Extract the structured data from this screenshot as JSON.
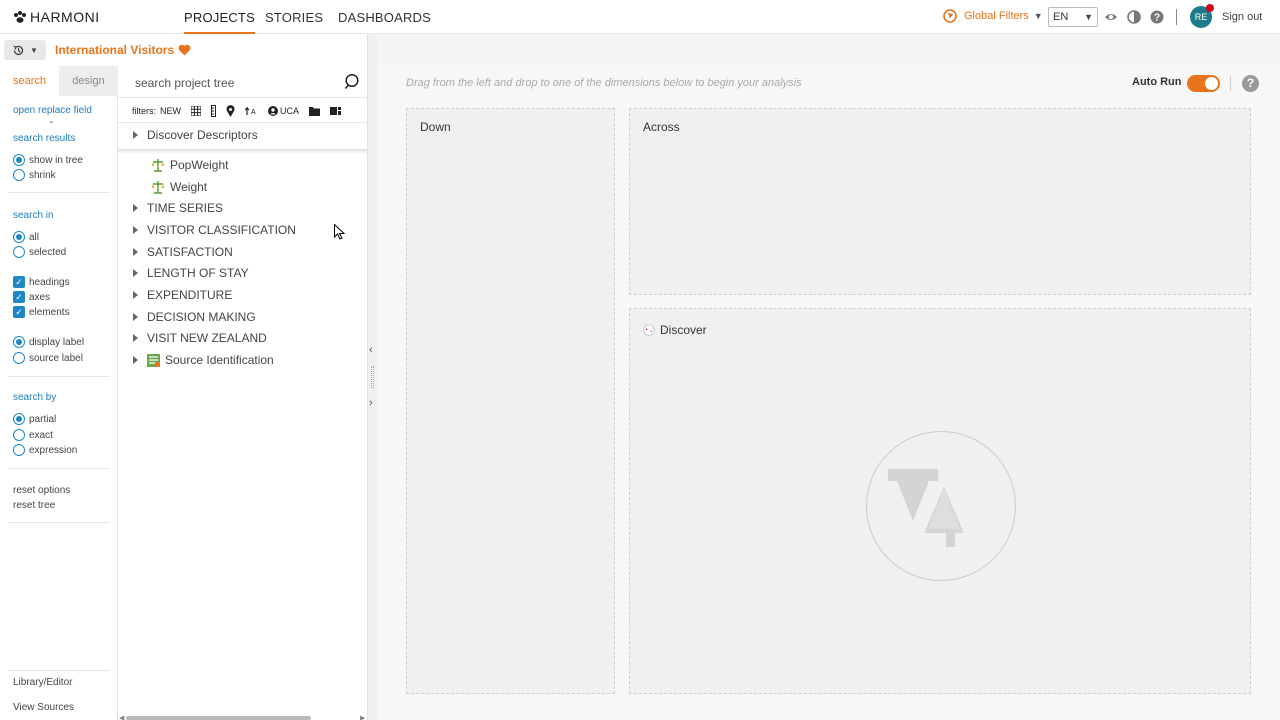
{
  "app": {
    "brand": "HARMONI",
    "nav": [
      {
        "label": "PROJECTS",
        "active": true
      },
      {
        "label": "STORIES",
        "active": false
      },
      {
        "label": "DASHBOARDS",
        "active": false
      }
    ],
    "global_filters": "Global Filters",
    "language": "EN",
    "user_initials": "RE",
    "sign_out": "Sign out"
  },
  "project": {
    "title": "International Visitors"
  },
  "options": {
    "tabs": {
      "search": "search",
      "design": "design"
    },
    "open_replace_field": "open replace field",
    "search_results": {
      "heading": "search results",
      "show_in_tree": "show in tree",
      "shrink": "shrink"
    },
    "search_in": {
      "heading": "search in",
      "all": "all",
      "selected": "selected"
    },
    "checks": {
      "headings": "headings",
      "axes": "axes",
      "elements": "elements"
    },
    "labels": {
      "display": "display label",
      "source": "source label"
    },
    "search_by": {
      "heading": "search by",
      "partial": "partial",
      "exact": "exact",
      "expression": "expression"
    },
    "reset_options": "reset options",
    "reset_tree": "reset tree",
    "library_editor": "Library/Editor",
    "view_sources": "View Sources"
  },
  "tree": {
    "search_placeholder": "search project tree",
    "filters_label": "filters:",
    "filter_new": "NEW",
    "filter_uca": "UCA",
    "items": [
      {
        "label": "Discover Descriptors",
        "type": "folder"
      },
      {
        "label": "PopWeight",
        "type": "weight"
      },
      {
        "label": "Weight",
        "type": "weight"
      },
      {
        "label": "TIME SERIES",
        "type": "folder"
      },
      {
        "label": "VISITOR CLASSIFICATION",
        "type": "folder"
      },
      {
        "label": "SATISFACTION",
        "type": "folder"
      },
      {
        "label": "LENGTH OF STAY",
        "type": "folder"
      },
      {
        "label": "EXPENDITURE",
        "type": "folder"
      },
      {
        "label": "DECISION MAKING",
        "type": "folder"
      },
      {
        "label": "VISIT NEW ZEALAND",
        "type": "folder"
      },
      {
        "label": "Source Identification",
        "type": "source"
      }
    ]
  },
  "main": {
    "hint": "Drag from the left and drop to one of the dimensions below to begin your analysis",
    "auto_run": "Auto Run",
    "auto_run_on": true,
    "down": "Down",
    "across": "Across",
    "discover": "Discover"
  },
  "colors": {
    "accent": "#e8741b",
    "link": "#1e7bbf",
    "avatar": "#1f7a8c"
  }
}
